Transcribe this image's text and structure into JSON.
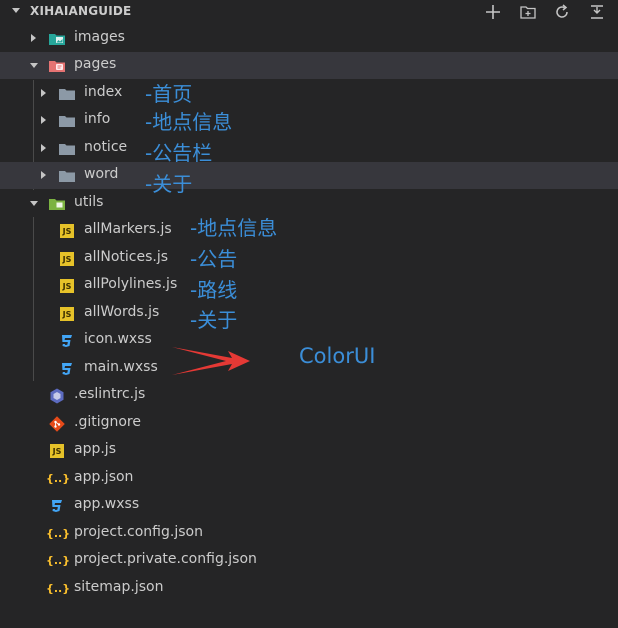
{
  "explorer": {
    "title": "XIHAIANGUIDE",
    "actions": [
      {
        "name": "new-file-icon"
      },
      {
        "name": "new-folder-icon"
      },
      {
        "name": "refresh-icon"
      },
      {
        "name": "collapse-all-icon"
      }
    ]
  },
  "tree": {
    "images": "images",
    "pages": "pages",
    "index": "index",
    "info": "info",
    "notice": "notice",
    "word": "word",
    "utils": "utils",
    "allMarkers": "allMarkers.js",
    "allNotices": "allNotices.js",
    "allPolylines": "allPolylines.js",
    "allWords": "allWords.js",
    "icon_wxss": "icon.wxss",
    "main_wxss": "main.wxss",
    "eslintrc": ".eslintrc.js",
    "gitignore": ".gitignore",
    "app_js": "app.js",
    "app_json": "app.json",
    "app_wxss": "app.wxss",
    "project_config": "project.config.json",
    "project_private_config": "project.private.config.json",
    "sitemap": "sitemap.json"
  },
  "annotations": {
    "index": "-首页",
    "info": "-地点信息",
    "notice": "-公告栏",
    "word": "-关于",
    "allMarkers": "-地点信息",
    "allNotices": "-公告",
    "allPolylines": "-路线",
    "allWords": "-关于",
    "colorui": "ColorUI"
  },
  "icons": {
    "js_badge": "JS",
    "json_badge": "{..}"
  },
  "colors": {
    "background": "#252526",
    "selected_row": "#37373d",
    "annotation_blue": "#3b8ed8",
    "arrow_red": "#e53935",
    "folder_grey": "#8c99a6",
    "js_yellow": "#e6c229",
    "css_blue": "#42a5f5",
    "git_orange": "#e64a19"
  }
}
